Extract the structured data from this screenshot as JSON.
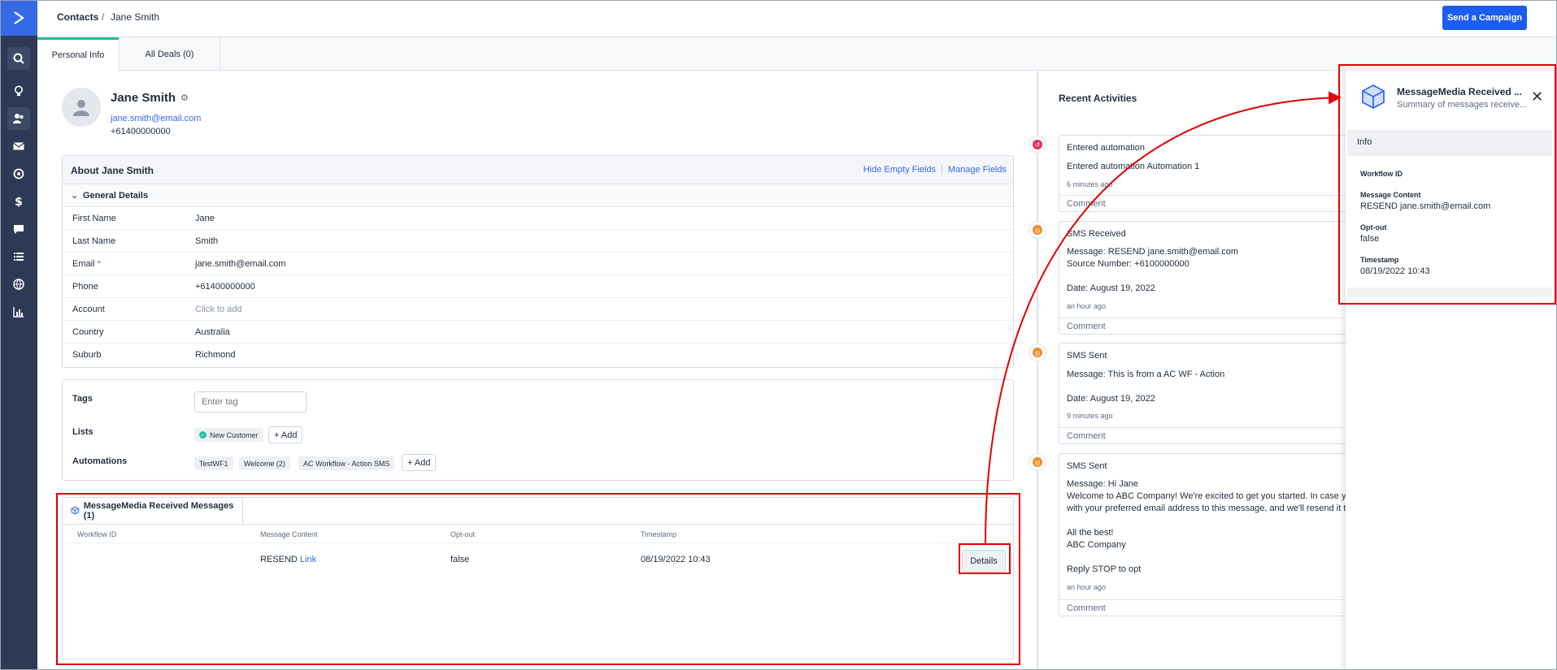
{
  "breadcrumb": {
    "root": "Contacts",
    "separator": "/",
    "current": "Jane Smith"
  },
  "header": {
    "campaign_button": "Send a Campaign"
  },
  "tabs": [
    {
      "label": "Personal Info"
    },
    {
      "label": "All Deals (0)"
    }
  ],
  "contact": {
    "name": "Jane Smith",
    "email": "jane.smith@email.com",
    "phone": "+61400000000"
  },
  "about": {
    "title": "About Jane Smith",
    "hide_empty": "Hide Empty Fields",
    "link_divider": "|",
    "manage_fields": "Manage Fields",
    "section": "General Details",
    "fields": [
      {
        "label": "First Name",
        "value": "Jane"
      },
      {
        "label": "Last Name",
        "value": "Smith"
      },
      {
        "label": "Email",
        "required": "*",
        "value": "jane.smith@email.com"
      },
      {
        "label": "Phone",
        "value": "+61400000000"
      },
      {
        "label": "Account",
        "value": "Click to add"
      },
      {
        "label": "Country",
        "value": "Australia"
      },
      {
        "label": "Suburb",
        "value": "Richmond"
      }
    ]
  },
  "tags": {
    "tags_label": "Tags",
    "tag_placeholder": "Enter tag",
    "lists_label": "Lists",
    "list_chip": "New Customer",
    "add_label": "+ Add",
    "automations_label": "Automations",
    "automation_chips": [
      "TestWF1",
      "Welcome  (2)",
      "AC Workflow - Action SMS"
    ]
  },
  "messagemedia": {
    "tab_label": "MessageMedia Received Messages (1)",
    "columns": [
      "Workflow ID",
      "Message Content",
      "Opt-out",
      "Timestamp"
    ],
    "row": {
      "workflow_id": "",
      "content_prefix": "RESEND",
      "content_link": "Link",
      "opt_out": "false",
      "timestamp": "08/19/2022 10:43"
    },
    "details_button": "Details"
  },
  "activities": {
    "title": "Recent Activities",
    "comment_label": "Comment",
    "items": [
      {
        "title": "Entered automation",
        "lines": [
          "Entered automation Automation 1"
        ],
        "time": "6 minutes ago",
        "color": "#e0315d"
      },
      {
        "title": "SMS Received",
        "lines": [
          "Message: RESEND jane.smith@email.com",
          "Source Number: +6100000000",
          "",
          "Date: August 19, 2022"
        ],
        "time": "an hour ago",
        "color": "#f08a24"
      },
      {
        "title": "SMS Sent",
        "lines": [
          "Message: This is from a AC WF - Action",
          "",
          "Date: August 19, 2022"
        ],
        "time": "9 minutes ago",
        "color": "#f08a24"
      },
      {
        "title": "SMS Sent",
        "lines": [
          "Message: Hi Jane",
          "Welcome to ABC Company! We're excited to get you started. In case you r",
          "with your preferred email address to this message, and we'll resend it to y",
          "",
          "All the best!",
          "ABC Company",
          "",
          "Reply STOP to opt"
        ],
        "time": "an hour ago",
        "color": "#f08a24"
      }
    ]
  },
  "drawer": {
    "title": "MessageMedia Received ...",
    "subtitle": "Summary of messages receive...",
    "info_label": "Info",
    "fields": [
      {
        "label": "Workflow ID",
        "value": ""
      },
      {
        "label": "Message Content",
        "value": "RESEND jane.smith@email.com"
      },
      {
        "label": "Opt-out",
        "value": "false"
      },
      {
        "label": "Timestamp",
        "value": "08/19/2022 10:43"
      }
    ]
  },
  "colors": {
    "brand": "#356ae6",
    "primary_button": "#1a5df0",
    "rail": "#2e3a55",
    "annotation": "#e20000",
    "tab_accent": "#1dbf9e"
  },
  "icons": [
    "logo-icon",
    "search-icon",
    "lightbulb-icon",
    "contacts-icon",
    "mail-icon",
    "target-icon",
    "dollar-icon",
    "chat-icon",
    "list-icon",
    "globe-icon",
    "bar-chart-icon",
    "gear-icon",
    "avatar-icon",
    "chevron-down-icon",
    "cube-icon",
    "close-icon"
  ]
}
